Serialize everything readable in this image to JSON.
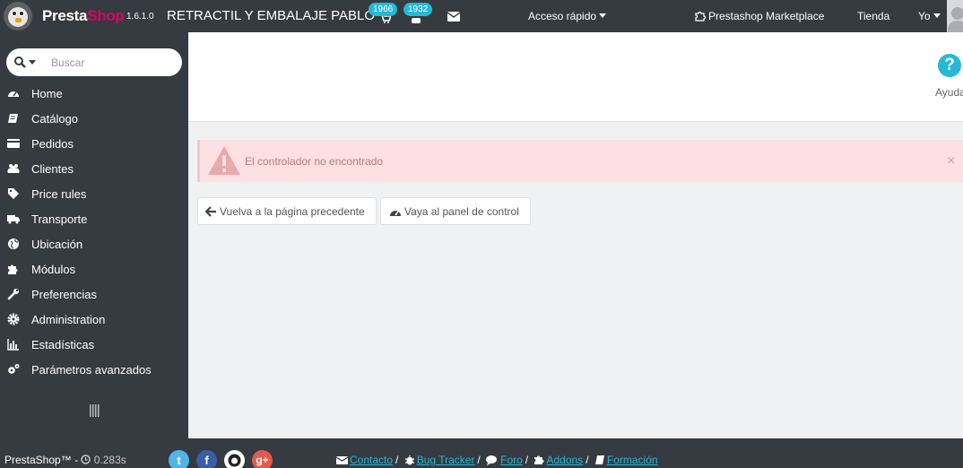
{
  "header": {
    "brand_presta": "Presta",
    "brand_shop": "Shop",
    "version": "1.6.1.0",
    "shop_name": "RETRACTIL Y EMBALAJE PABLO",
    "orders_badge": "1966",
    "customers_badge": "1932",
    "quick_access": "Acceso rápido",
    "marketplace": "Prestashop Marketplace",
    "store": "Tienda",
    "user": "Yo"
  },
  "sidebar": {
    "search_placeholder": "Buscar",
    "items": [
      {
        "label": "Home",
        "icon": "dashboard-icon"
      },
      {
        "label": "Catálogo",
        "icon": "book-icon"
      },
      {
        "label": "Pedidos",
        "icon": "credit-card-icon"
      },
      {
        "label": "Clientes",
        "icon": "users-icon"
      },
      {
        "label": "Price rules",
        "icon": "tags-icon"
      },
      {
        "label": "Transporte",
        "icon": "truck-icon"
      },
      {
        "label": "Ubicación",
        "icon": "globe-icon"
      },
      {
        "label": "Módulos",
        "icon": "puzzle-icon"
      },
      {
        "label": "Preferencias",
        "icon": "wrench-icon"
      },
      {
        "label": "Administration",
        "icon": "gear-icon"
      },
      {
        "label": "Estadísticas",
        "icon": "bar-chart-icon"
      },
      {
        "label": "Parámetros avanzados",
        "icon": "gears-icon"
      }
    ]
  },
  "toolbar": {
    "help_label": "Ayuda"
  },
  "alert": {
    "message": "El controlador no encontrado",
    "close": "×"
  },
  "buttons": {
    "back": "Vuelva a la página precedente",
    "dashboard": "Vaya al panel de control"
  },
  "footer": {
    "brand": "PrestaShop™",
    "separator": "-",
    "load_time": "0.283s",
    "links": [
      "Contacto",
      "Bug Tracker",
      "Foro",
      "Addons",
      "Formación"
    ]
  },
  "colors": {
    "dark": "#363a41",
    "accent": "#25b9d7",
    "brand_pink": "#df0067",
    "alert_bg": "#fde0e1",
    "twitter": "#4fb5e8",
    "facebook": "#3b5ea8",
    "github": "#444444",
    "google": "#e55a4c"
  }
}
